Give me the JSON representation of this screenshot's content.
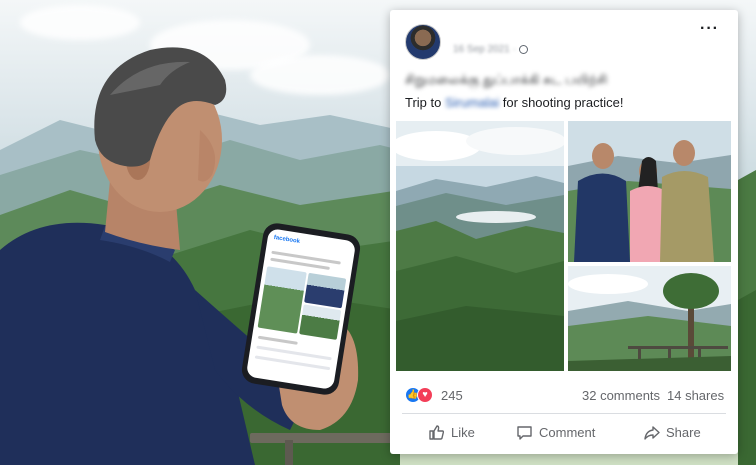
{
  "post": {
    "date": "16 Sep 2021 ·",
    "caption_native": "சிறுமலைக்கு துப்பாக்கி சுட பயிற்சி",
    "caption_prefix": "Trip to ",
    "caption_place": "Sirumalai",
    "caption_suffix": " for shooting practice!"
  },
  "stats": {
    "reactions": "245",
    "comments": "32 comments",
    "shares": "14 shares"
  },
  "actions": {
    "like": "Like",
    "comment": "Comment",
    "share": "Share"
  },
  "phone": {
    "app_name": "facebook"
  },
  "icons": {
    "more": "more-options-icon",
    "globe": "globe-icon",
    "like": "thumbs-up-icon",
    "love": "heart-icon",
    "comment": "comment-icon",
    "share": "share-arrow-icon"
  },
  "colors": {
    "facebook_blue": "#1877f2",
    "love_red": "#f33e58",
    "meta_text": "#65676b"
  }
}
